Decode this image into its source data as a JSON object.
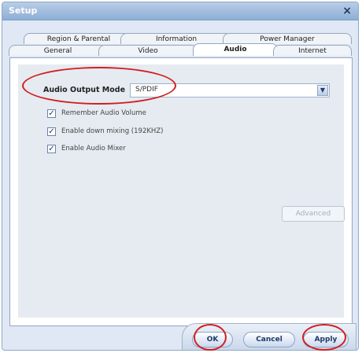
{
  "window": {
    "title": "Setup",
    "close_glyph": "×"
  },
  "tabs": {
    "row1": [
      "Region & Parental",
      "Information",
      "Power Manager"
    ],
    "row2": [
      "General",
      "Video",
      "Audio",
      "Internet"
    ],
    "active": "Audio"
  },
  "audio": {
    "output_mode_label": "Audio Output Mode",
    "output_mode_value": "S/PDIF",
    "dropdown_glyph": "▼",
    "options": [
      {
        "label": "Remember Audio Volume",
        "checked": true
      },
      {
        "label": "Enable down mixing (192KHZ)",
        "checked": true
      },
      {
        "label": "Enable Audio Mixer",
        "checked": true
      }
    ],
    "advanced_label": "Advanced"
  },
  "footer": {
    "ok": "OK",
    "cancel": "Cancel",
    "apply": "Apply"
  },
  "colors": {
    "highlight_ring": "#d11f1f",
    "accent": "#1f3a66"
  }
}
